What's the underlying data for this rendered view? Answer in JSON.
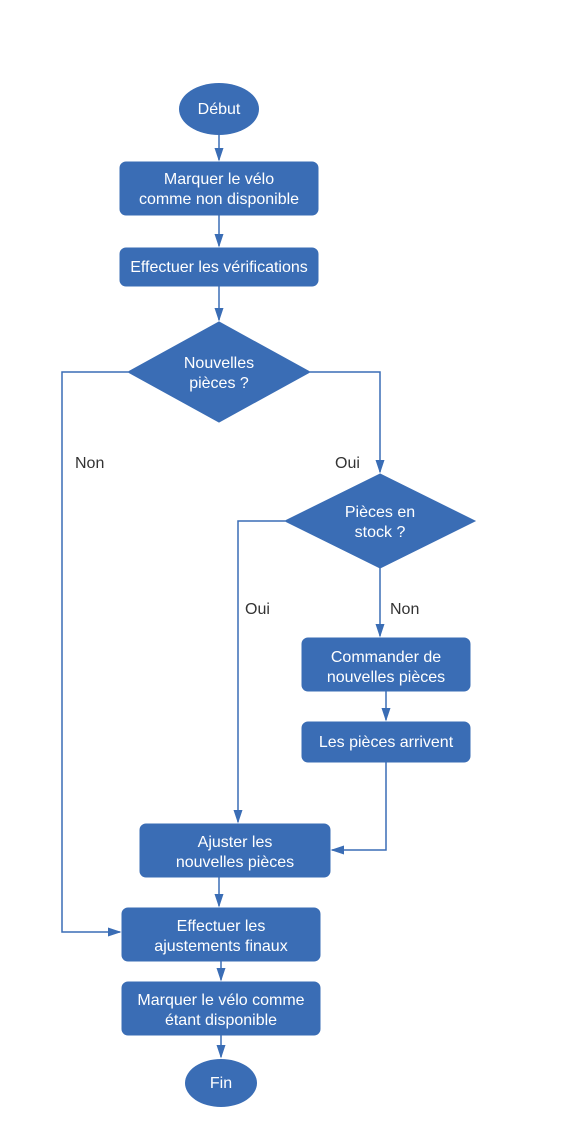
{
  "flowchart": {
    "start": "Début",
    "step1_line1": "Marquer le vélo",
    "step1_line2": "comme non disponible",
    "step2": "Effectuer les vérifications",
    "decision1_line1": "Nouvelles",
    "decision1_line2": "pièces ?",
    "decision2_line1": "Pièces en",
    "decision2_line2": "stock ?",
    "step3_line1": "Commander de",
    "step3_line2": "nouvelles pièces",
    "step4": "Les pièces arrivent",
    "step5_line1": "Ajuster les",
    "step5_line2": "nouvelles pièces",
    "step6_line1": "Effectuer les",
    "step6_line2": "ajustements finaux",
    "step7_line1": "Marquer le vélo comme",
    "step7_line2": "étant disponible",
    "end": "Fin",
    "labels": {
      "non": "Non",
      "oui": "Oui"
    }
  }
}
